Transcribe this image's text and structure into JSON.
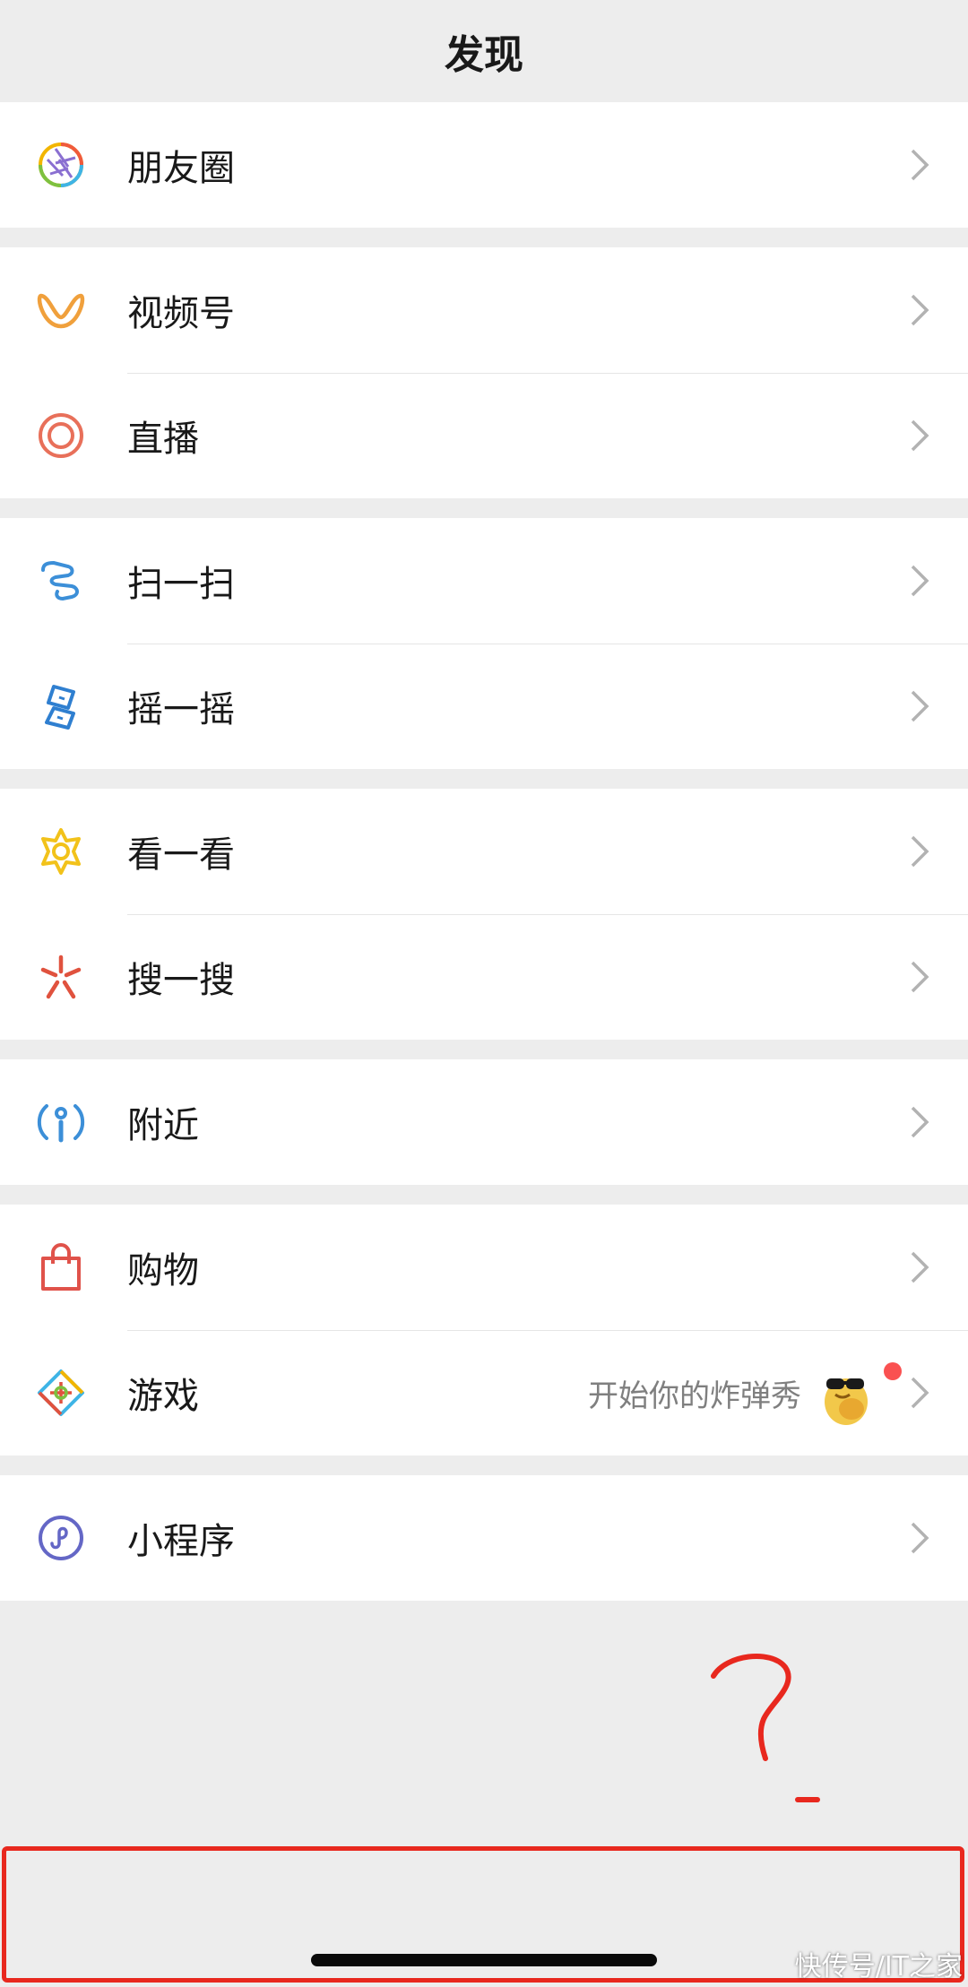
{
  "header": {
    "title": "发现"
  },
  "items": {
    "moments": {
      "label": "朋友圈"
    },
    "channels": {
      "label": "视频号"
    },
    "live": {
      "label": "直播"
    },
    "scan": {
      "label": "扫一扫"
    },
    "shake": {
      "label": "摇一摇"
    },
    "top_stories": {
      "label": "看一看"
    },
    "search": {
      "label": "搜一搜"
    },
    "nearby": {
      "label": "附近"
    },
    "shopping": {
      "label": "购物"
    },
    "games": {
      "label": "游戏",
      "subtitle": "开始你的炸弹秀"
    },
    "mini_programs": {
      "label": "小程序"
    }
  },
  "watermark": "快传号/IT之家",
  "colors": {
    "background": "#ededed",
    "cell": "#ffffff",
    "badge_red": "#fa5151",
    "annotation_red": "#e8281e"
  }
}
